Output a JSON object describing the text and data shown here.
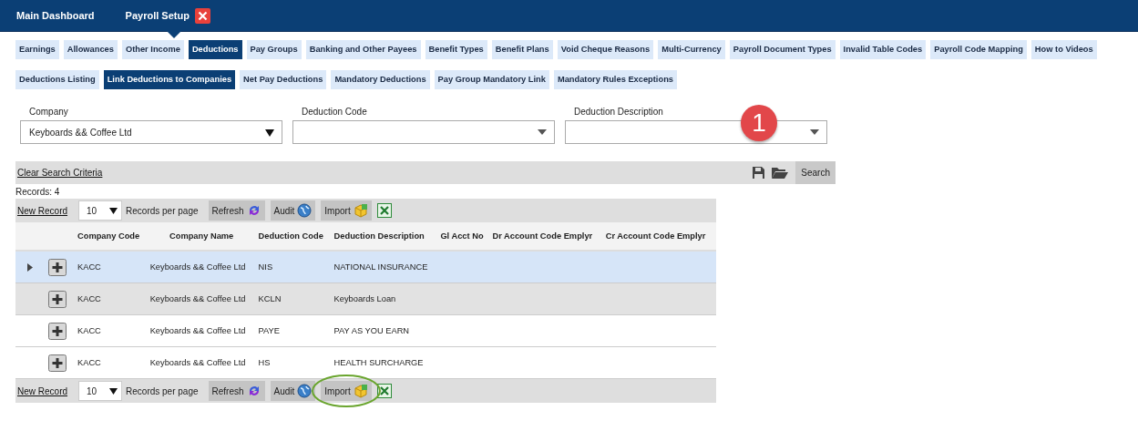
{
  "header": {
    "tabs": [
      {
        "label": "Main Dashboard",
        "selected": false,
        "closable": false
      },
      {
        "label": "Payroll Setup",
        "selected": true,
        "closable": true
      }
    ]
  },
  "main_tabs": [
    {
      "label": "Earnings",
      "selected": false
    },
    {
      "label": "Allowances",
      "selected": false
    },
    {
      "label": "Other Income",
      "selected": false
    },
    {
      "label": "Deductions",
      "selected": true
    },
    {
      "label": "Pay Groups",
      "selected": false
    },
    {
      "label": "Banking and Other Payees",
      "selected": false
    },
    {
      "label": "Benefit Types",
      "selected": false
    },
    {
      "label": "Benefit Plans",
      "selected": false
    },
    {
      "label": "Void Cheque Reasons",
      "selected": false
    },
    {
      "label": "Multi-Currency",
      "selected": false
    },
    {
      "label": "Payroll Document Types",
      "selected": false
    },
    {
      "label": "Invalid Table Codes",
      "selected": false
    },
    {
      "label": "Payroll Code Mapping",
      "selected": false
    },
    {
      "label": "How to Videos",
      "selected": false
    }
  ],
  "sub_tabs": [
    {
      "label": "Deductions Listing",
      "selected": false
    },
    {
      "label": "Link Deductions to Companies",
      "selected": true
    },
    {
      "label": "Net Pay Deductions",
      "selected": false
    },
    {
      "label": "Mandatory Deductions",
      "selected": false
    },
    {
      "label": "Pay Group Mandatory Link",
      "selected": false
    },
    {
      "label": "Mandatory Rules Exceptions",
      "selected": false
    }
  ],
  "callout": "1",
  "filters": [
    {
      "label": "Company",
      "value": "Keyboards && Coffee Ltd",
      "kind": "solid"
    },
    {
      "label": "Deduction Code",
      "kind": "caret"
    },
    {
      "label": "Deduction Description",
      "kind": "caret"
    }
  ],
  "search_bar": {
    "clear": "Clear Search Criteria",
    "search": "Search"
  },
  "records": "Records:  4",
  "toolbar_top": {
    "new_record": "New Record",
    "page_size": "10",
    "per_page": "Records per page",
    "buttons": [
      {
        "label": "Refresh",
        "kind": "refresh",
        "highlighted": false
      },
      {
        "label": "Audit",
        "kind": "audit",
        "highlighted": false
      },
      {
        "label": "Import",
        "kind": "import",
        "highlighted": false
      }
    ]
  },
  "table": {
    "columns": [
      "Company Code",
      "Company Name",
      "Deduction Code",
      "Deduction Description",
      "Gl Acct No",
      "Dr Account Code Emplyr",
      "Cr Account Code Emplyr"
    ],
    "rows": [
      {
        "selected": true,
        "cells": [
          "KACC",
          "Keyboards && Coffee Ltd",
          "NIS",
          "NATIONAL INSURANCE",
          "",
          "",
          ""
        ]
      },
      {
        "selected": false,
        "cells": [
          "KACC",
          "Keyboards && Coffee Ltd",
          "KCLN",
          "Keyboards Loan",
          "",
          "",
          ""
        ]
      },
      {
        "selected": false,
        "cells": [
          "KACC",
          "Keyboards && Coffee Ltd",
          "PAYE",
          "PAY AS YOU EARN",
          "",
          "",
          ""
        ]
      },
      {
        "selected": false,
        "cells": [
          "KACC",
          "Keyboards && Coffee Ltd",
          "HS",
          "HEALTH SURCHARGE",
          "",
          "",
          ""
        ]
      }
    ]
  },
  "toolbar_bottom": {
    "new_record": "New Record",
    "page_size": "10",
    "per_page": "Records per page",
    "buttons": [
      {
        "label": "Refresh",
        "kind": "refresh",
        "highlighted": false
      },
      {
        "label": "Audit",
        "kind": "audit",
        "highlighted": false
      },
      {
        "label": "Import",
        "kind": "import",
        "highlighted": true
      }
    ]
  }
}
